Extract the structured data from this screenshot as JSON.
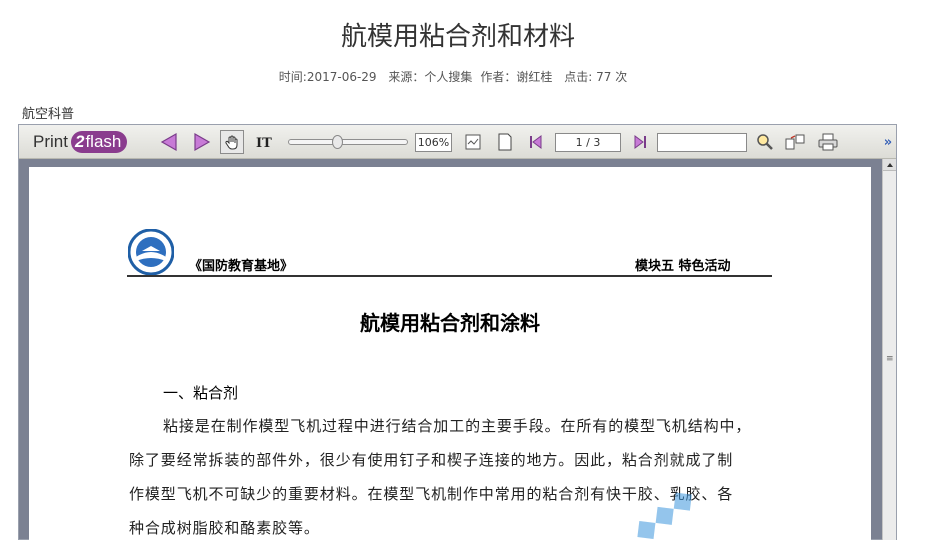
{
  "article": {
    "title": "航模用粘合剂和材料",
    "meta": {
      "time": "时间:2017-06-29",
      "source": "来源：个人搜集",
      "author": "作者：谢红桂",
      "clicks": "点击: 77 次"
    },
    "category": "航空科普"
  },
  "viewer": {
    "logo_print": "Print",
    "logo_two": "2",
    "logo_flash": "flash",
    "zoom_value": "106%",
    "page_value": "1 / 3",
    "search_value": "",
    "more_label": "»"
  },
  "document": {
    "header_left": "《国防教育基地》",
    "header_right": "模块五  特色活动",
    "title": "航模用粘合剂和涂料",
    "section_heading": "一、粘合剂",
    "body_lines": [
      "粘接是在制作模型飞机过程中进行结合加工的主要手段。在所有的模型飞机结构中，",
      "除了要经常拆装的部件外，很少有使用钉子和楔子连接的地方。因此，粘合剂就成了制",
      "作模型飞机不可缺少的重要材料。在模型飞机制作中常用的粘合剂有快干胶、乳胶、各",
      "种合成树脂胶和酪素胶等。"
    ]
  },
  "colors": {
    "logo_badge": "#8a3c8e",
    "arrow_fill": "#c77ad6",
    "viewer_background": "#7b8192"
  },
  "icons": [
    "left-arrow-icon",
    "right-arrow-icon",
    "hand-tool-icon",
    "text-select-icon",
    "fit-width-icon",
    "fit-page-icon",
    "prev-page-icon",
    "next-page-icon",
    "search-icon",
    "open-external-icon",
    "print-icon",
    "scroll-grip-icon",
    "seal-logo-icon"
  ]
}
